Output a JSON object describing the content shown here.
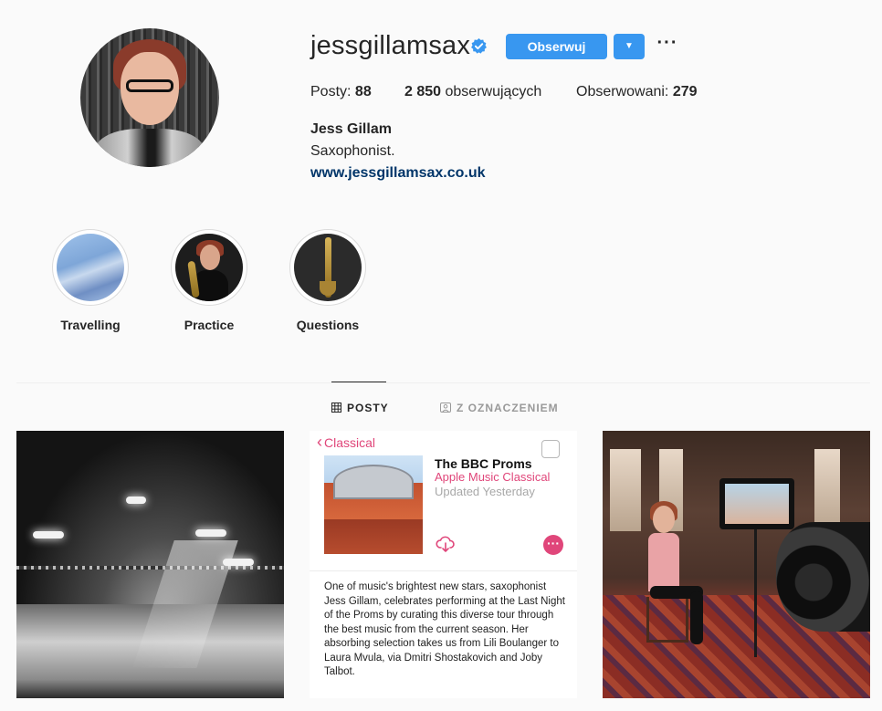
{
  "profile": {
    "username": "jessgillamsax",
    "verified": true,
    "follow_label": "Obserwuj",
    "more_label": "···",
    "dropdown_glyph": "▼",
    "stats": {
      "posts_label": "Posty:",
      "posts_value": "88",
      "followers_value": "2 850",
      "followers_label": "obserwujących",
      "following_label": "Obserwowani:",
      "following_value": "279"
    },
    "full_name": "Jess Gillam",
    "bio": "Saxophonist.",
    "website": "www.jessgillamsax.co.uk"
  },
  "highlights": [
    {
      "label": "Travelling"
    },
    {
      "label": "Practice"
    },
    {
      "label": "Questions"
    }
  ],
  "tabs": {
    "posts_label": "POSTY",
    "tagged_label": "Z OZNACZENIEM"
  },
  "posts": {
    "apple_music": {
      "back_label": "Classical",
      "title": "The BBC Proms",
      "subtitle": "Apple Music Classical",
      "updated": "Updated Yesterday",
      "description": "One of music's brightest new stars, saxophonist Jess Gillam, celebrates performing at the Last Night of the Proms by curating this diverse tour through the best music from the current season. Her absorbing selection takes us from Lili Boulanger to Laura Mvula, via Dmitri Shostakovich and Joby Talbot."
    }
  },
  "colors": {
    "accent": "#3897f0",
    "link": "#003569",
    "apple_pink": "#e0467a",
    "text": "#262626",
    "muted": "#999999",
    "background": "#fafafa"
  },
  "icons": {
    "verified": "verified-badge-icon",
    "dropdown": "caret-down-icon",
    "more": "ellipsis-icon",
    "posts_tab": "grid-icon",
    "tagged_tab": "tagged-person-icon",
    "download": "cloud-download-icon"
  }
}
